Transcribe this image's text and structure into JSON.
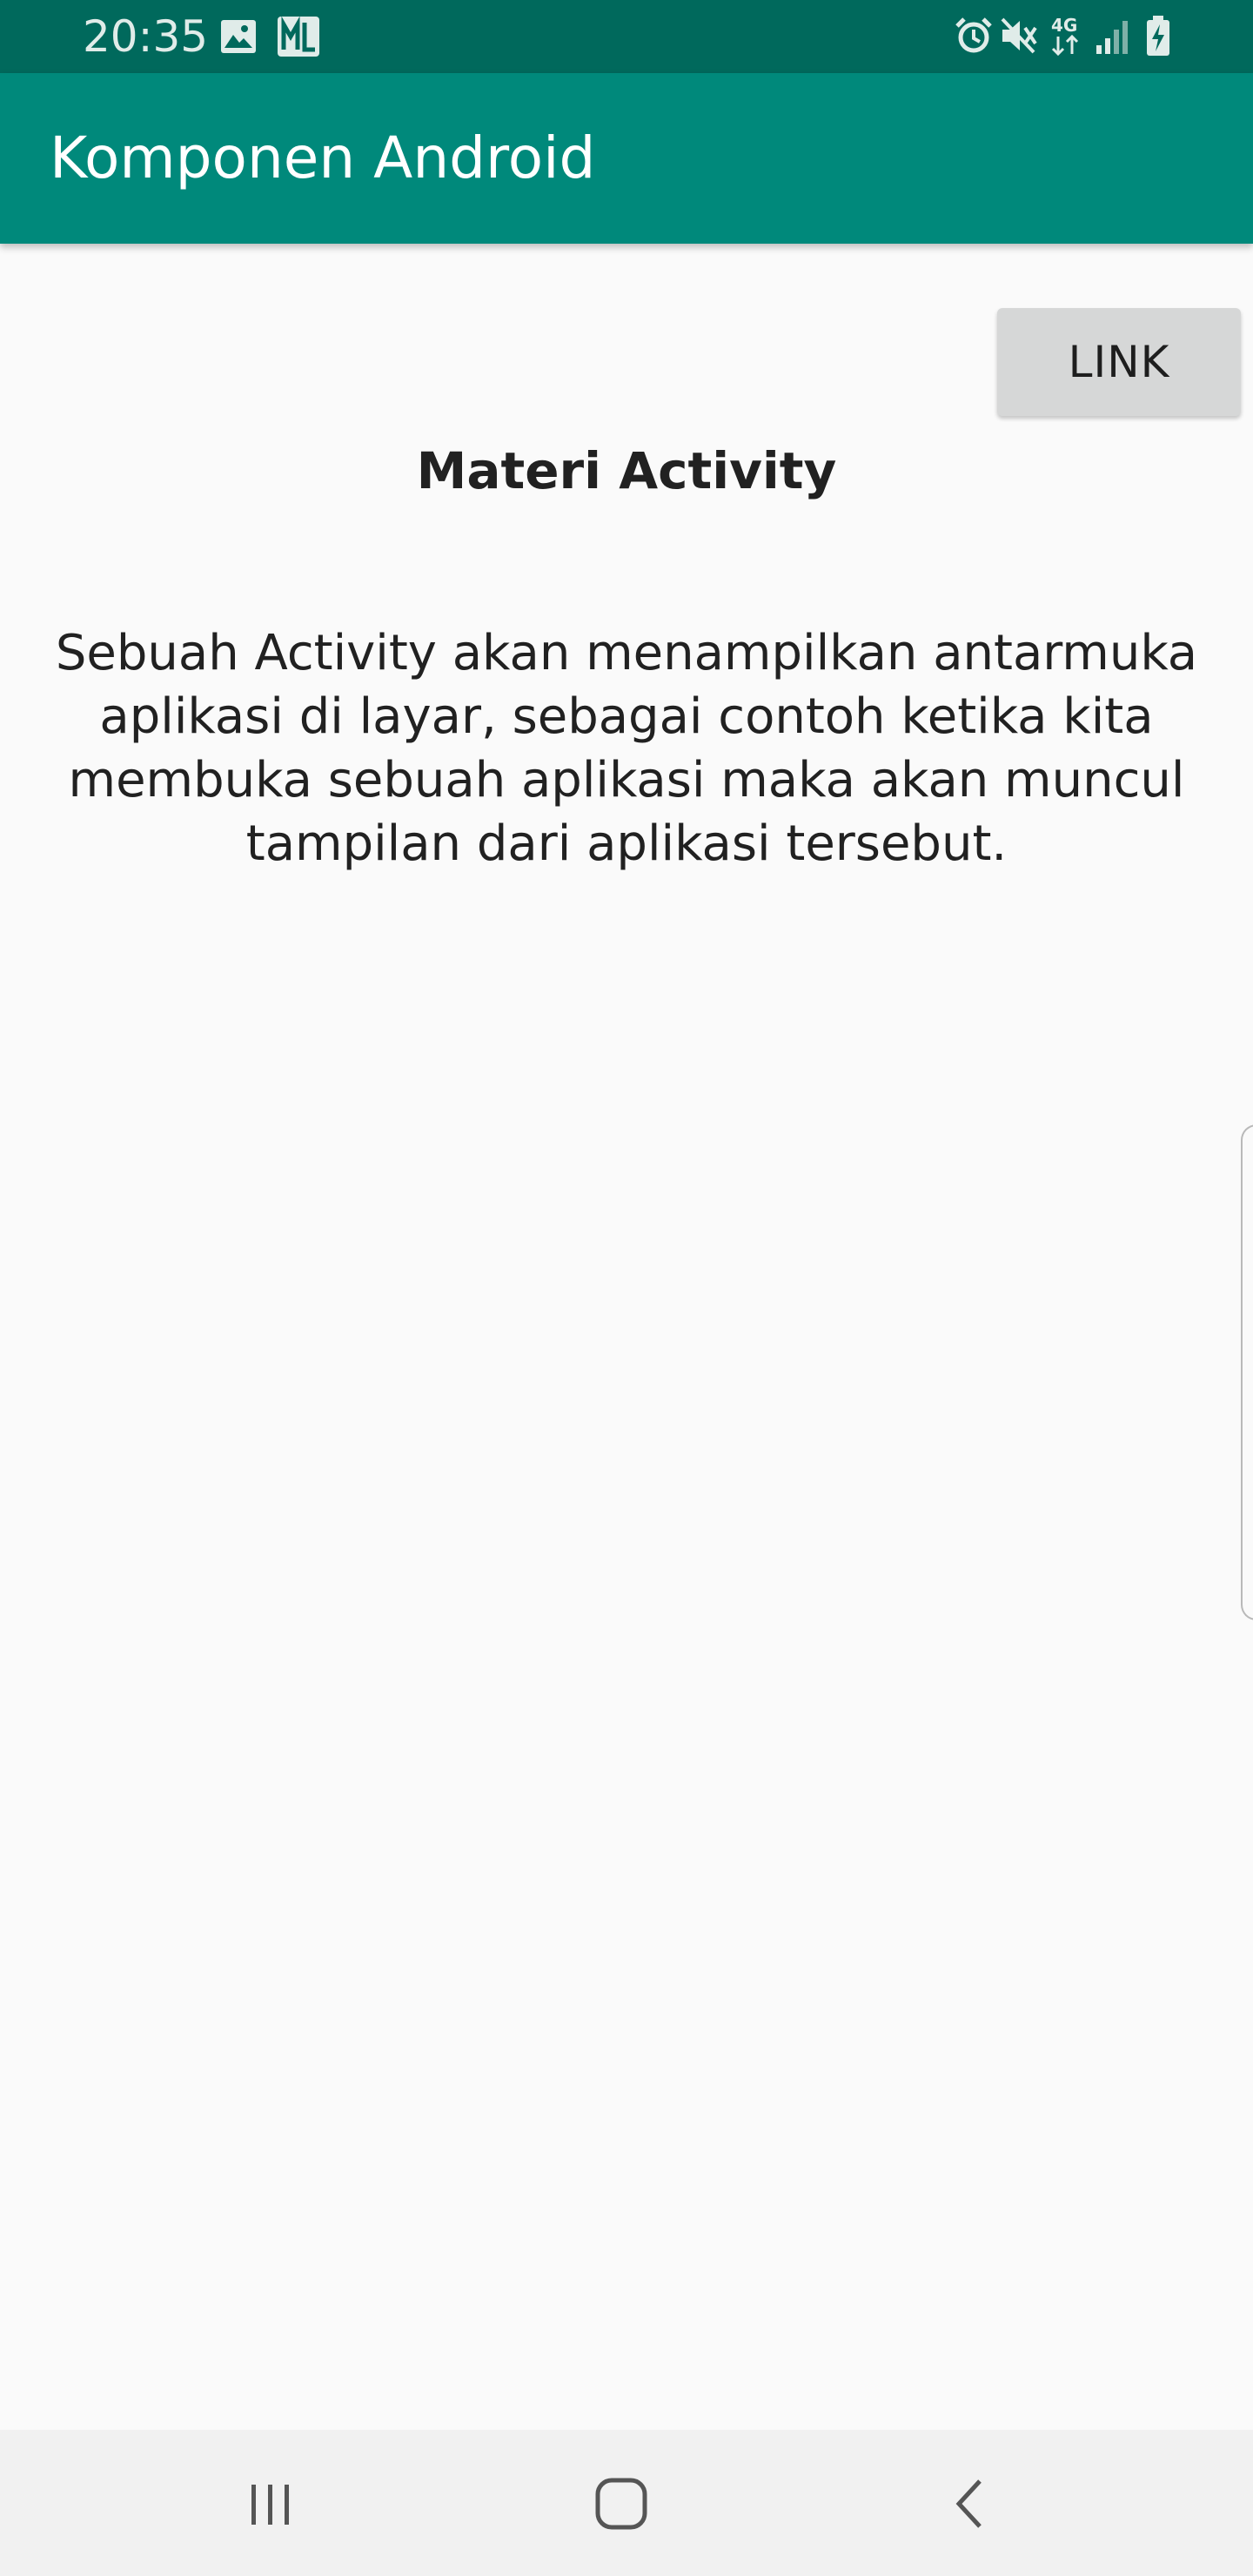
{
  "status_bar": {
    "time": "20:35",
    "left_icons": [
      "gallery-icon",
      "ml-app-icon"
    ],
    "right_icons": [
      "alarm-icon",
      "mute-icon",
      "network-4g-icon",
      "signal-icon",
      "battery-charging-icon"
    ],
    "network_label": "4G"
  },
  "app_bar": {
    "title": "Komponen Android",
    "color": "#00897b",
    "status_color": "#00695c"
  },
  "main": {
    "link_button_label": "LINK",
    "title": "Materi Activity",
    "body": "Sebuah Activity akan menampilkan antarmuka aplikasi di layar, sebagai contoh ketika kita membuka sebuah aplikasi maka akan muncul tampilan dari aplikasi tersebut."
  },
  "nav_bar": {
    "buttons": [
      "recent-apps-icon",
      "home-icon",
      "back-icon"
    ]
  }
}
